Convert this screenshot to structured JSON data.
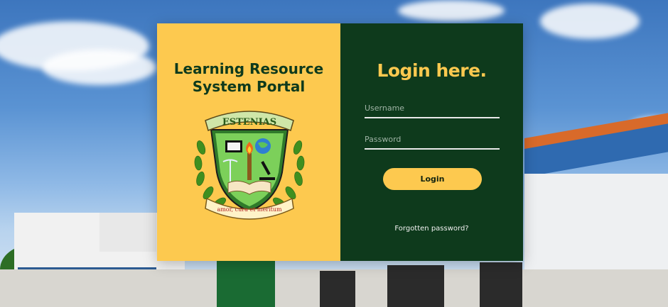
{
  "portal": {
    "title_line1": "Learning Resource",
    "title_line2": "System Portal",
    "emblem": {
      "top_banner": "ESTENIAS",
      "bottom_banner": "amor, cura et meritum"
    }
  },
  "login": {
    "heading": "Login here.",
    "username_placeholder": "Username",
    "password_placeholder": "Password",
    "button_label": "Login",
    "forgot_link": "Forgotten password?"
  },
  "colors": {
    "accent_yellow": "#fdc94f",
    "dark_green": "#0e3a1c"
  }
}
